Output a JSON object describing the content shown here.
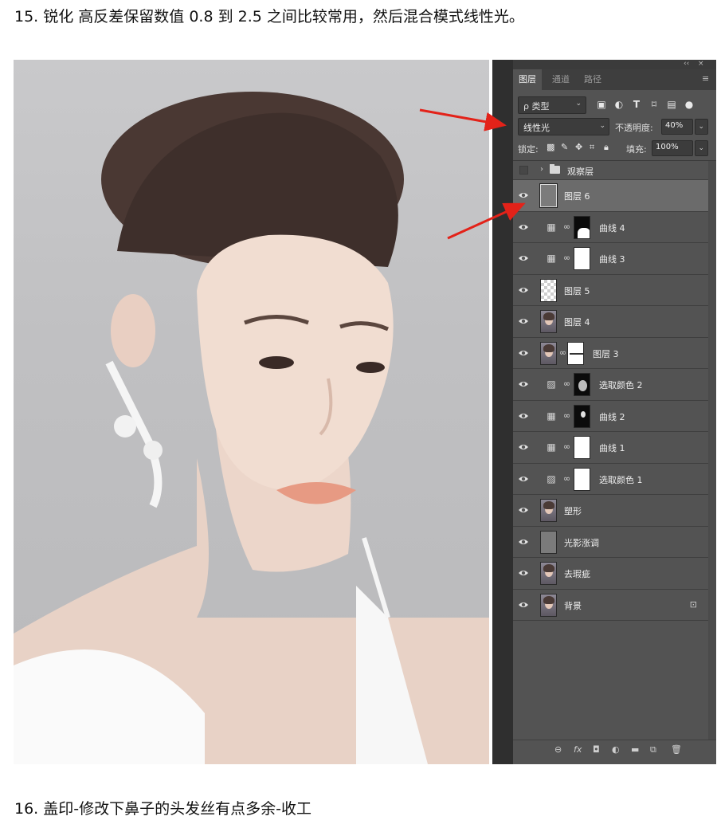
{
  "step15": "15.  锐化  高反差保留数值 0.8 到 2.5 之间比较常用，然后混合模式线性光。",
  "step16": "16. 盖印-修改下鼻子的头发丝有点多余-收工",
  "panel": {
    "tabs": [
      "图层",
      "通道",
      "路径"
    ],
    "active_tab": "图层",
    "filter_label": "ρ 类型",
    "blend_mode": "线性光",
    "opacity_label": "不透明度:",
    "opacity_value": "40%",
    "lock_label": "锁定:",
    "fill_label": "填充:",
    "fill_value": "100%"
  },
  "layers": [
    {
      "name": "观察层",
      "kind": "folder",
      "visible": false
    },
    {
      "name": "图层 6",
      "kind": "pixel",
      "visible": true,
      "selected": true
    },
    {
      "name": "曲线 4",
      "kind": "curves",
      "visible": true
    },
    {
      "name": "曲线 3",
      "kind": "curves",
      "visible": true
    },
    {
      "name": "图层 5",
      "kind": "pixel",
      "visible": true
    },
    {
      "name": "图层 4",
      "kind": "pixel",
      "visible": true
    },
    {
      "name": "图层 3",
      "kind": "pixel",
      "visible": true
    },
    {
      "name": "选取颜色 2",
      "kind": "selective-color",
      "visible": true
    },
    {
      "name": "曲线 2",
      "kind": "curves",
      "visible": true
    },
    {
      "name": "曲线 1",
      "kind": "curves",
      "visible": true
    },
    {
      "name": "选取颜色 1",
      "kind": "selective-color",
      "visible": true
    },
    {
      "name": "塑形",
      "kind": "pixel",
      "visible": true
    },
    {
      "name": "光影涨调",
      "kind": "pixel",
      "visible": true
    },
    {
      "name": "去瑕疵",
      "kind": "pixel",
      "visible": true
    },
    {
      "name": "背景",
      "kind": "pixel",
      "visible": true,
      "locked": true
    }
  ],
  "colors": {
    "panel_bg": "#535353",
    "selected_row": "#6b6b6b",
    "annotation_arrow": "#e32219"
  }
}
